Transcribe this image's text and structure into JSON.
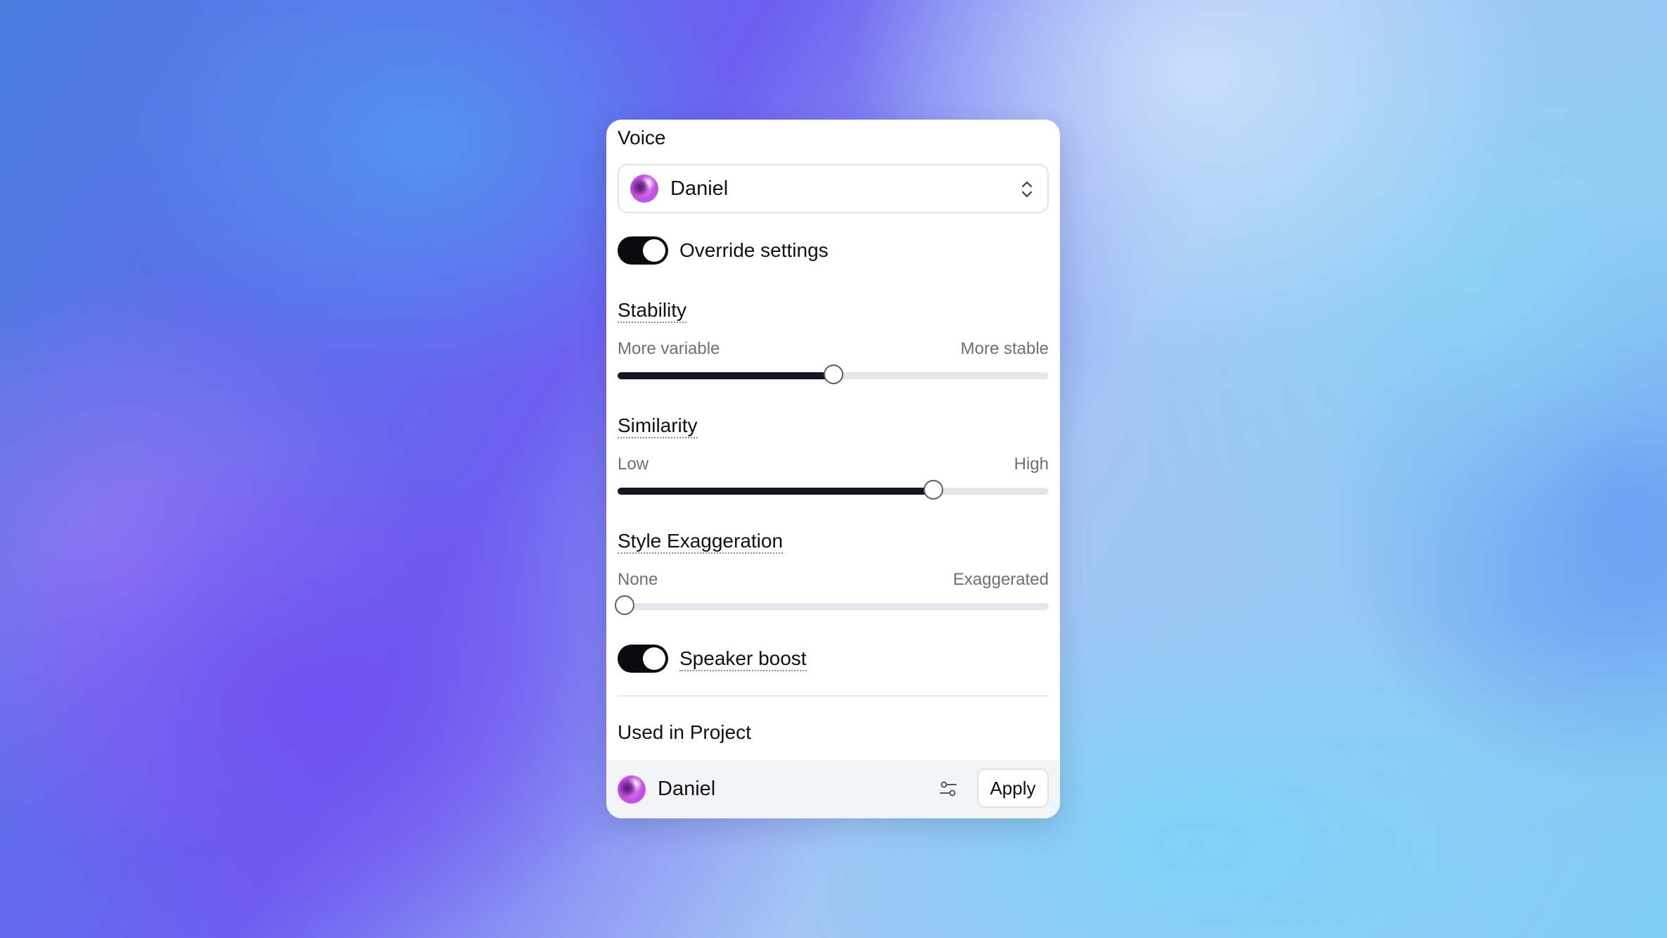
{
  "voice": {
    "title": "Voice",
    "selected": "Daniel"
  },
  "override": {
    "label": "Override settings",
    "enabled": true
  },
  "stability": {
    "title": "Stability",
    "min_label": "More variable",
    "max_label": "More stable",
    "value": 0.5
  },
  "similarity": {
    "title": "Similarity",
    "min_label": "Low",
    "max_label": "High",
    "value": 0.74
  },
  "style": {
    "title": "Style Exaggeration",
    "min_label": "None",
    "max_label": "Exaggerated",
    "value": 0.0
  },
  "speaker_boost": {
    "label": "Speaker boost",
    "enabled": true
  },
  "project": {
    "title": "Used in Project",
    "voice_name": "Daniel",
    "apply_label": "Apply"
  },
  "icons": {
    "voice_avatar": "avatar-orb",
    "select_chevrons": "chevron-up-down-icon",
    "settings": "sliders-icon"
  },
  "colors": {
    "track_fill": "#141526",
    "track_bg": "#e5e6ea",
    "toggle_on": "#0b0b0f"
  }
}
